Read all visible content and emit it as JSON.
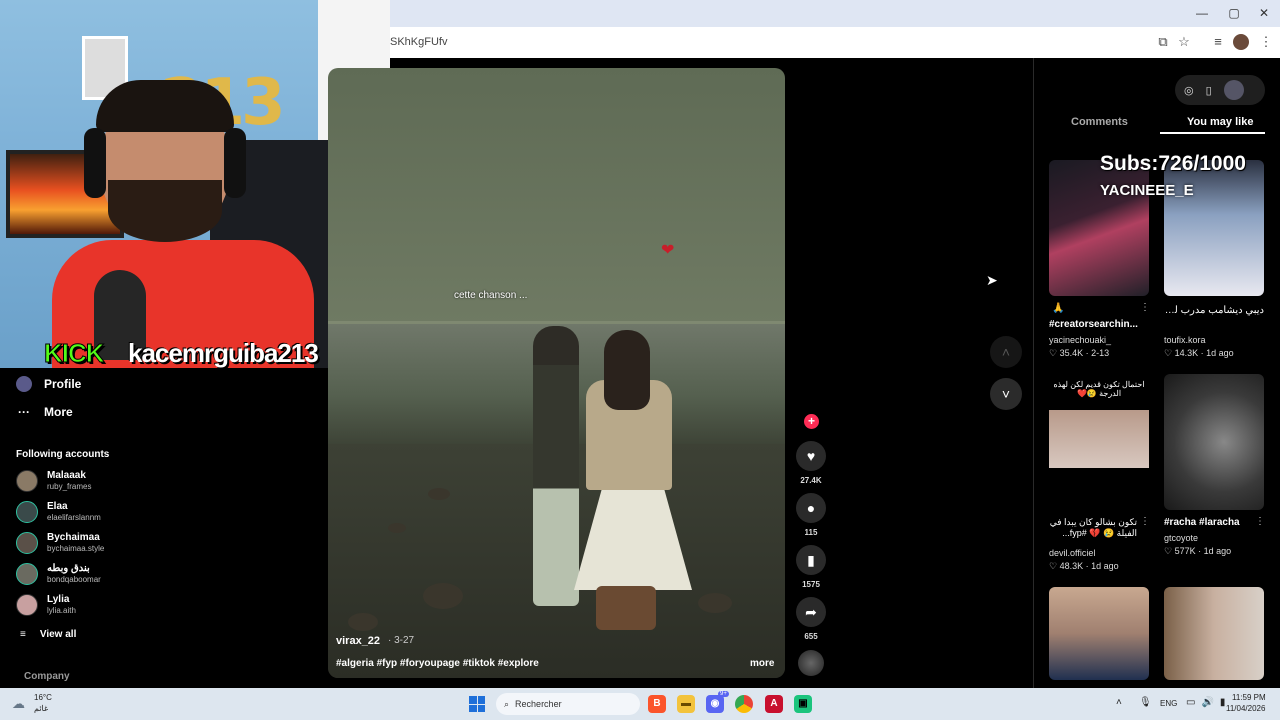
{
  "browser": {
    "url": "SKhKgFUfv"
  },
  "stream_overlay": {
    "platform": "KICK",
    "channel": "kacemrguiba213",
    "balloons": "213"
  },
  "sidebar": {
    "nav": [
      {
        "label": "Profile",
        "icon": "profile-avatar-icon"
      },
      {
        "label": "More",
        "icon": "more-dots-icon"
      }
    ],
    "following_title": "Following accounts",
    "accounts": [
      {
        "name": "Malaaak",
        "handle": "ruby_frames"
      },
      {
        "name": "Elaa",
        "handle": "elaelifarslannm"
      },
      {
        "name": "Bychaimaa",
        "handle": "bychaimaa.style"
      },
      {
        "name": "بندق وبطه",
        "handle": "bondqaboomar"
      },
      {
        "name": "Lylia",
        "handle": "lylia.aith"
      }
    ],
    "view_all": "View all",
    "company": "Company"
  },
  "video": {
    "caption": "cette chanson ...",
    "author": "virax_22",
    "date": "· 3-27",
    "hashtags": "#algeria #fyp #foryoupage #tiktok #explore",
    "more": "more"
  },
  "actions": {
    "likes": "27.4K",
    "comments": "115",
    "saves": "1575",
    "shares": "655"
  },
  "right_panel": {
    "tabs": [
      "Comments",
      "You may like"
    ],
    "active_tab": "You may like",
    "overlay_subs": "Subs:726/1000",
    "overlay_name": "YACINEEE_E",
    "cards": [
      {
        "title": "#creatorsearchin...",
        "author": "yacinechouaki_",
        "likes": "35.4K",
        "date": "2-13"
      },
      {
        "title": "ديبي ديشامب مدرب لريال مدريد 😱 ...",
        "author": "toufix.kora",
        "likes": "14.3K",
        "date": "1d ago"
      },
      {
        "title": "تكون بشالو كان يبدا في الفيلة 😢 💔 #fyp...",
        "author": "devil.officiel",
        "likes": "48.3K",
        "date": "1d ago",
        "thumb_text": "احتمال تكون قديم لكن لهذه الدرجة 😢❤️"
      },
      {
        "title": "#racha #laracha",
        "author": "gtcoyote",
        "likes": "577K",
        "date": "1d ago"
      },
      {
        "title": "",
        "author": "",
        "likes": "",
        "date": ""
      },
      {
        "title": "",
        "author": "",
        "likes": "",
        "date": ""
      }
    ]
  },
  "taskbar": {
    "weather_temp": "16°C",
    "weather_desc": "غائم",
    "search_placeholder": "Rechercher",
    "lang": "ENG",
    "time": "11:59 PM",
    "date": "11/04/2026",
    "discord_badge": "9+"
  },
  "colors": {
    "accent": "#fe2c55",
    "kick_green": "#53fc18",
    "taskbar_bg": "#dde6ef"
  }
}
